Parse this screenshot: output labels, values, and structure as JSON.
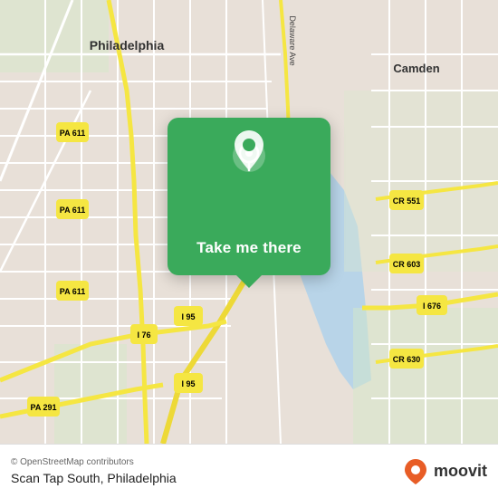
{
  "map": {
    "attribution": "© OpenStreetMap contributors",
    "location_label": "Scan Tap South, Philadelphia",
    "bg_color": "#e8e0d8",
    "water_color": "#b8d4e8",
    "road_color_yellow": "#f5e642",
    "road_color_white": "#ffffff",
    "road_color_light": "#d4c8b8"
  },
  "popup": {
    "button_label": "Take me there",
    "icon_name": "location-pin-icon"
  },
  "labels": {
    "philadelphia": "Philadelphia",
    "camden": "Camden",
    "pa611_1": "PA 611",
    "pa611_2": "PA 611",
    "pa611_3": "PA 611",
    "pa291": "PA 291",
    "i95_1": "I 95",
    "i95_2": "I 95",
    "i76": "I 76",
    "i676": "I 676",
    "cr551": "CR 551",
    "cr603": "CR 603",
    "cr630": "CR 630",
    "delaware_ave": "Delaware Ave"
  },
  "moovit": {
    "logo_text": "moovit"
  },
  "bottom_bar": {
    "attribution": "© OpenStreetMap contributors",
    "location": "Scan Tap South, Philadelphia"
  }
}
